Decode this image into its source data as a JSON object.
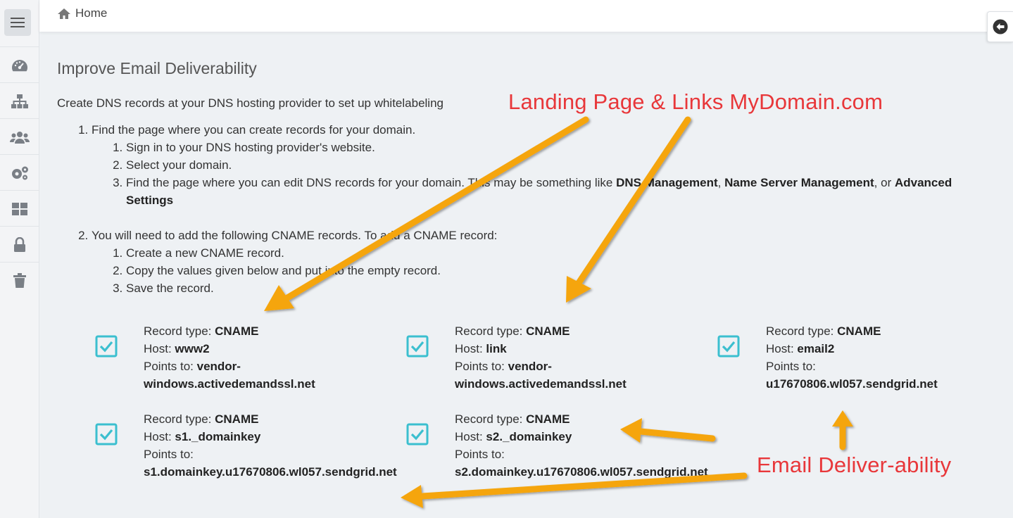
{
  "topbar": {
    "home_label": "Home"
  },
  "sidebar": {
    "items": [
      {
        "icon": "speedometer-icon"
      },
      {
        "icon": "sitemap-icon"
      },
      {
        "icon": "users-icon"
      },
      {
        "icon": "gears-icon"
      },
      {
        "icon": "grid-icon"
      },
      {
        "icon": "lock-icon"
      },
      {
        "icon": "trash-icon"
      }
    ]
  },
  "main": {
    "title": "Improve Email Deliverability",
    "intro": "Create DNS records at your DNS hosting provider to set up whitelabeling",
    "step1": {
      "text": "Find the page where you can create records for your domain.",
      "substeps": [
        "Sign in to your DNS hosting provider's website.",
        "Select your domain."
      ],
      "substep3_prefix": "Find the page where you can edit DNS records for your domain. This may be something like ",
      "substep3_b1": "DNS Management",
      "substep3_sep": ", ",
      "substep3_b2": "Name Server Management",
      "substep3_or": ", or ",
      "substep3_b3": "Advanced Settings"
    },
    "step2": {
      "text": "You will need to add the following CNAME records. To add a CNAME record:",
      "substeps": [
        "Create a new CNAME record.",
        "Copy the values given below and put into the empty record.",
        "Save the record."
      ]
    }
  },
  "labels": {
    "record_type": "Record type: ",
    "host": "Host: ",
    "points_to": "Points to: "
  },
  "records": [
    {
      "type": "CNAME",
      "host": "www2",
      "points_line1": "vendor-",
      "points_line2": "windows.activedemandssl.net",
      "checked": true
    },
    {
      "type": "CNAME",
      "host": "link",
      "points_line1": "vendor-",
      "points_line2": "windows.activedemandssl.net",
      "checked": true
    },
    {
      "type": "CNAME",
      "host": "email2",
      "points_line1": "",
      "points_line2": "u17670806.wl057.sendgrid.net",
      "checked": true
    },
    {
      "type": "CNAME",
      "host": "s1._domainkey",
      "points_line1": "",
      "points_line2": "s1.domainkey.u17670806.wl057.sendgrid.net",
      "checked": true
    },
    {
      "type": "CNAME",
      "host": "s2._domainkey",
      "points_line1": "",
      "points_line2": "s2.domainkey.u17670806.wl057.sendgrid.net",
      "checked": true
    }
  ],
  "annotations": {
    "landing": "Landing Page & Links MyDomain.com",
    "email": "Email Deliver-ability"
  },
  "colors": {
    "check": "#3bbfcf",
    "arrow": "#f5a50a",
    "annotation": "#e8373a"
  }
}
